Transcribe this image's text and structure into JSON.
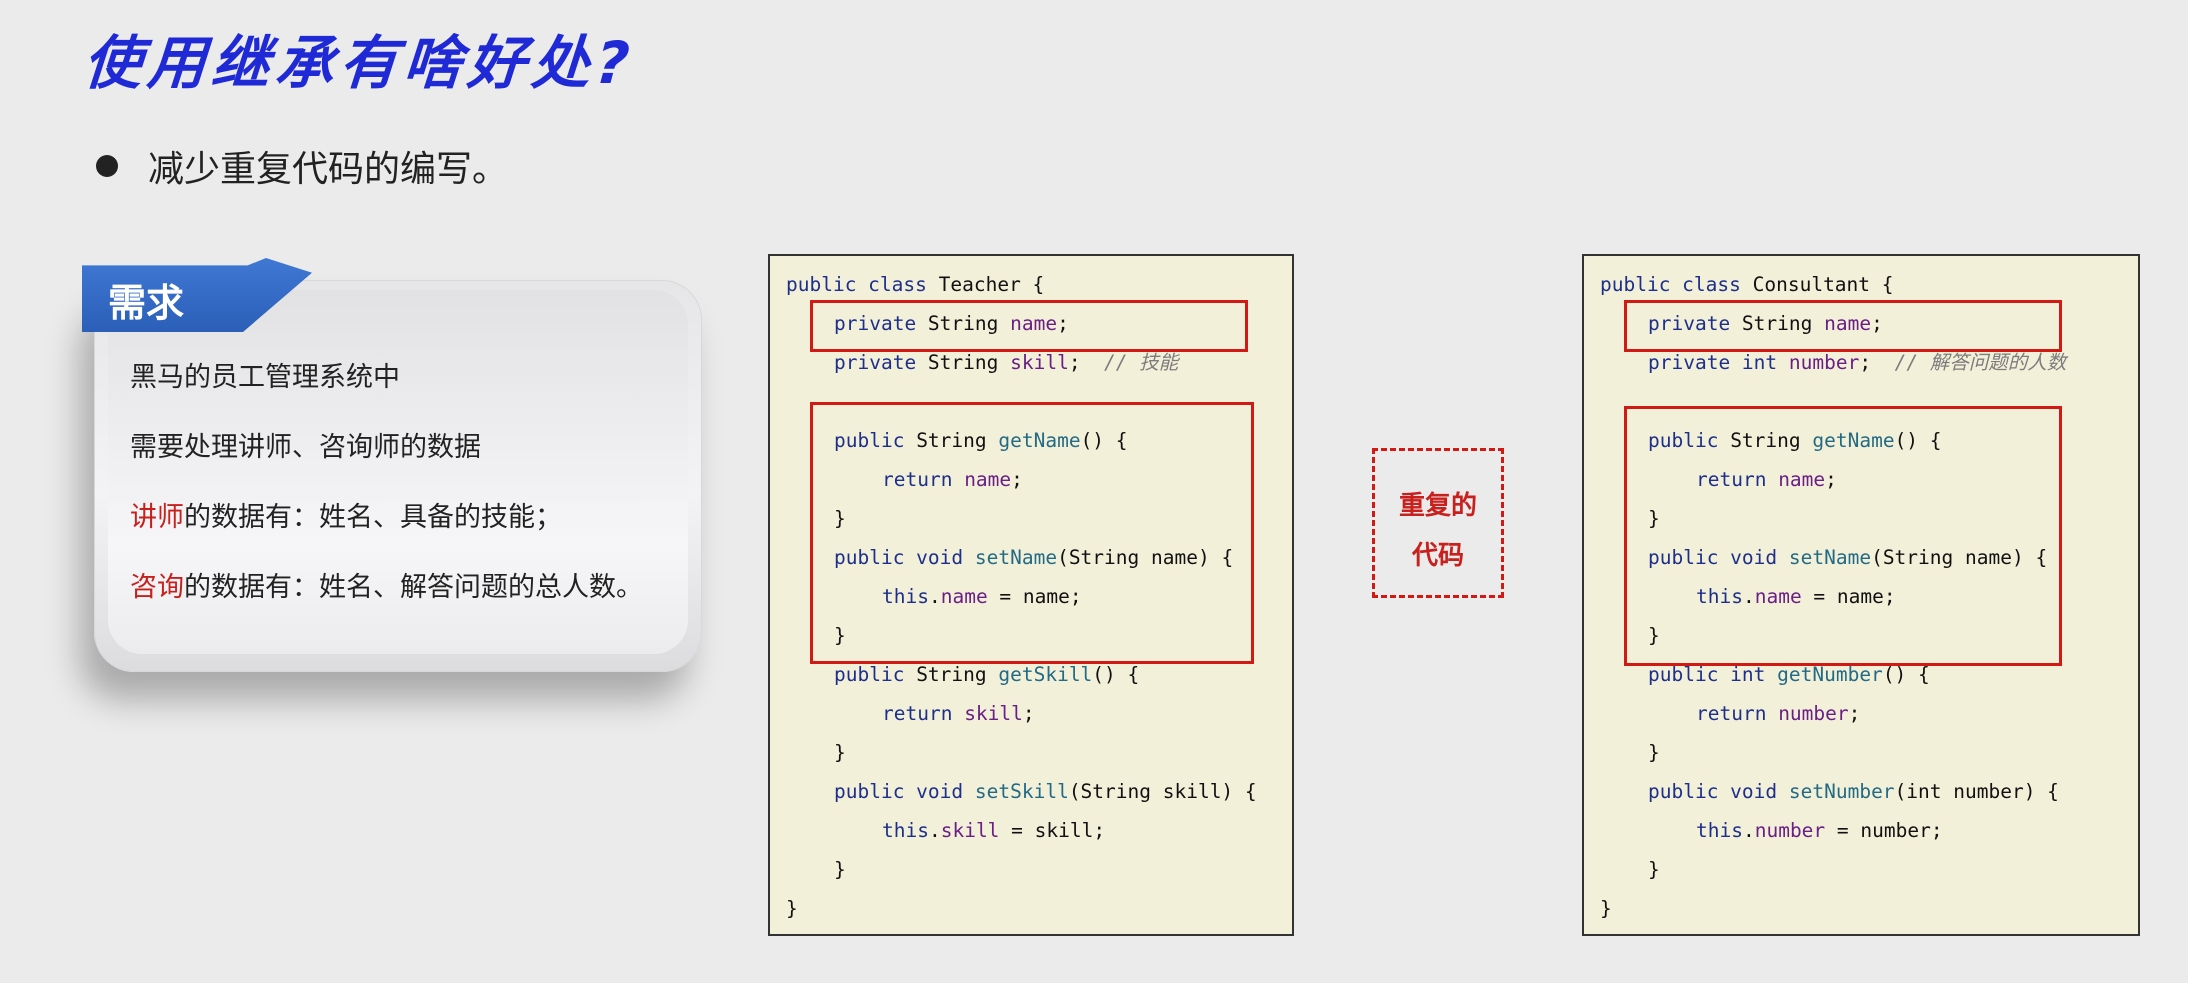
{
  "title": "使用继承有啥好处?",
  "bullet": "减少重复代码的编写。",
  "requirement": {
    "tab_label": "需求",
    "line1": "黑马的员工管理系统中",
    "line2": "需要处理讲师、咨询师的数据",
    "line3_highlight": "讲师",
    "line3_rest": "的数据有：姓名、具备的技能；",
    "line4_highlight": "咨询",
    "line4_rest": "的数据有：姓名、解答问题的总人数。"
  },
  "teacher_code": {
    "l1_kw": "public class",
    "l1_rest": " Teacher {",
    "l2_kw": "private",
    "l2_type": " String ",
    "l2_fld": "name",
    "l2_end": ";",
    "l3_kw": "private",
    "l3_type": " String ",
    "l3_fld": "skill",
    "l3_end": ";  ",
    "l3_cmt": "// 技能",
    "l4_kw": "public",
    "l4_type": " String ",
    "l4_mth": "getName",
    "l4_end": "() {",
    "l5_kw": "return ",
    "l5_fld": "name",
    "l5_end": ";",
    "l6": "}",
    "l7_kw": "public void ",
    "l7_mth": "setName",
    "l7_end": "(String name) {",
    "l8_kw": "this",
    "l8_dot": ".",
    "l8_fld": "name",
    "l8_end": " = name;",
    "l9": "}",
    "l10_kw": "public",
    "l10_type": " String ",
    "l10_mth": "getSkill",
    "l10_end": "() {",
    "l11_kw": "return ",
    "l11_fld": "skill",
    "l11_end": ";",
    "l12": "}",
    "l13_kw": "public void ",
    "l13_mth": "setSkill",
    "l13_end": "(String skill) {",
    "l14_kw": "this",
    "l14_dot": ".",
    "l14_fld": "skill",
    "l14_end": " = skill;",
    "l15": "}",
    "l16": "}"
  },
  "duplicate_label": {
    "line1": "重复的",
    "line2": "代码"
  },
  "consultant_code": {
    "l1_kw": "public class",
    "l1_rest": " Consultant {",
    "l2_kw": "private",
    "l2_type": " String ",
    "l2_fld": "name",
    "l2_end": ";",
    "l3_kw": "private int ",
    "l3_fld": "number",
    "l3_end": ";  ",
    "l3_cmt": "// 解答问题的人数",
    "l4_kw": "public",
    "l4_type": " String ",
    "l4_mth": "getName",
    "l4_end": "() {",
    "l5_kw": "return ",
    "l5_fld": "name",
    "l5_end": ";",
    "l6": "}",
    "l7_kw": "public void ",
    "l7_mth": "setName",
    "l7_end": "(String name) {",
    "l8_kw": "this",
    "l8_dot": ".",
    "l8_fld": "name",
    "l8_end": " = name;",
    "l9": "}",
    "l10_kw": "public int ",
    "l10_mth": "getNumber",
    "l10_end": "() {",
    "l11_kw": "return ",
    "l11_fld": "number",
    "l11_end": ";",
    "l12": "}",
    "l13_kw": "public void ",
    "l13_mth": "setNumber",
    "l13_end": "(int number) {",
    "l14_kw": "this",
    "l14_dot": ".",
    "l14_fld": "number",
    "l14_end": " = number;",
    "l15": "}",
    "l16": "}"
  },
  "colors": {
    "title": "#1f2ad6",
    "highlight": "#c8201d",
    "code_bg": "#f3f0da",
    "keyword": "#1d2f8a",
    "field": "#6a1f85",
    "method": "#236a84"
  }
}
